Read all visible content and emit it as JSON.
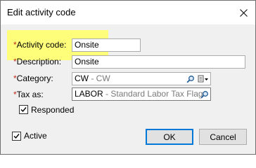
{
  "window": {
    "title": "Edit activity code"
  },
  "form": {
    "activity_code": {
      "asterisk": "*",
      "label": "Activity code:",
      "value": "Onsite"
    },
    "description": {
      "asterisk": "*",
      "label": "Description:",
      "value": "Onsite"
    },
    "category": {
      "asterisk": "*",
      "label": "Category:",
      "value_code": "CW",
      "value_desc": " - CW"
    },
    "tax_as": {
      "asterisk": "*",
      "label": "Tax as:",
      "value_code": "LABOR",
      "value_desc": " - Standard Labor Tax Flag"
    },
    "responded": {
      "label": "Responded",
      "checked": true
    }
  },
  "footer": {
    "active": {
      "label": "Active",
      "checked": true
    },
    "ok_label": "OK",
    "cancel_label": "Cancel"
  },
  "colors": {
    "highlight": "#ffff6e",
    "required": "#c0281e",
    "default_button_border": "#0078d7"
  }
}
